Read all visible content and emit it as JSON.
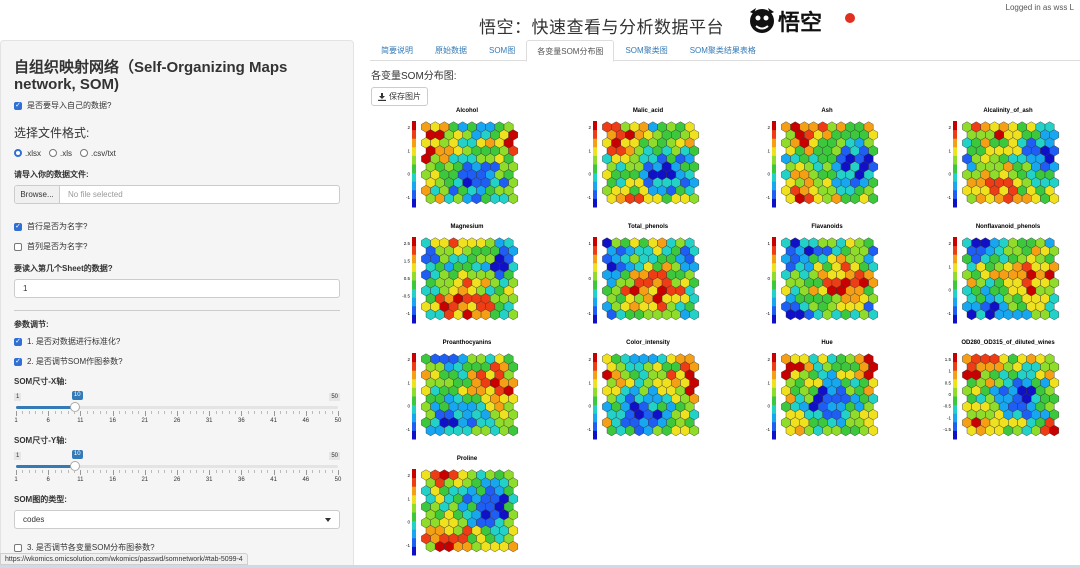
{
  "header": {
    "title": "悟空：快速查看与分析数据平台",
    "logo_text": "悟空",
    "login_text": "Logged in as wss L"
  },
  "sidebar": {
    "title": "自组织映射网络（Self-Organizing Maps network, SOM)",
    "import_own_data": {
      "label": "是否要导入自己的数据?",
      "checked": true
    },
    "file_format_label": "选择文件格式:",
    "file_formats": [
      {
        "label": ".xlsx",
        "selected": true
      },
      {
        "label": ".xls",
        "selected": false
      },
      {
        "label": ".csv/txt",
        "selected": false
      }
    ],
    "import_file_label": "请导入你的数据文件:",
    "browse_label": "Browse...",
    "file_placeholder": "No file selected",
    "first_row_names": {
      "label": "首行是否为名字?",
      "checked": true
    },
    "first_col_names": {
      "label": "首列是否为名字?",
      "checked": false
    },
    "sheet_label": "要读入第几个Sheet的数据?",
    "sheet_value": "1",
    "params_label": "参数调节:",
    "standardize": {
      "label": "1. 是否对数据进行标准化?",
      "checked": true
    },
    "adjust_som": {
      "label": "2. 是否调节SOM作图参数?",
      "checked": true
    },
    "slider_x": {
      "label": "SOM尺寸-X轴:",
      "min": "1",
      "max": "50",
      "value": "10",
      "ticks": [
        "1",
        "6",
        "11",
        "16",
        "21",
        "26",
        "31",
        "36",
        "41",
        "46",
        "50"
      ]
    },
    "slider_y": {
      "label": "SOM尺寸-Y轴:",
      "min": "1",
      "max": "50",
      "value": "10",
      "ticks": [
        "1",
        "6",
        "11",
        "16",
        "21",
        "26",
        "31",
        "36",
        "41",
        "46",
        "50"
      ]
    },
    "som_type_label": "SOM图的类型:",
    "som_type_value": "codes",
    "adjust_each_var": {
      "label": "3. 是否调节各变量SOM分布图参数?",
      "checked": false
    }
  },
  "main": {
    "tabs": [
      {
        "label": "简要说明",
        "active": false
      },
      {
        "label": "原始数据",
        "active": false
      },
      {
        "label": "SOM图",
        "active": false
      },
      {
        "label": "各变量SOM分布图",
        "active": true
      },
      {
        "label": "SOM聚类图",
        "active": false
      },
      {
        "label": "SOM聚类结果表格",
        "active": false
      }
    ],
    "heading": "各变量SOM分布图:",
    "save_button": "保存图片",
    "plots": [
      {
        "title": "Alcohol",
        "ticks": [
          "2",
          "1",
          "0",
          "-1"
        ]
      },
      {
        "title": "Malic_acid",
        "ticks": [
          "2",
          "1",
          "0",
          "-1"
        ]
      },
      {
        "title": "Ash",
        "ticks": [
          "2",
          "1",
          "0",
          "-1"
        ]
      },
      {
        "title": "Alcalinity_of_ash",
        "ticks": [
          "2",
          "1",
          "0",
          "-1"
        ]
      },
      {
        "title": "Magnesium",
        "ticks": [
          "2.5",
          "1.5",
          "0.5",
          "-0.5",
          "-1"
        ]
      },
      {
        "title": "Total_phenols",
        "ticks": [
          "1",
          "0",
          "-1"
        ]
      },
      {
        "title": "Flavanoids",
        "ticks": [
          "1",
          "0",
          "-1"
        ]
      },
      {
        "title": "Nonflavanoid_phenols",
        "ticks": [
          "2",
          "1",
          "0",
          "-1"
        ]
      },
      {
        "title": "Proanthocyanins",
        "ticks": [
          "2",
          "1",
          "0",
          "-1"
        ]
      },
      {
        "title": "Color_intensity",
        "ticks": [
          "2",
          "1",
          "0",
          "-1"
        ]
      },
      {
        "title": "Hue",
        "ticks": [
          "2",
          "1",
          "0",
          "-1"
        ]
      },
      {
        "title": "OD280_OD315_of_diluted_wines",
        "ticks": [
          "1.5",
          "1",
          "0.5",
          "0",
          "-0.5",
          "-1",
          "-1.5"
        ]
      },
      {
        "title": "Proline",
        "ticks": [
          "2",
          "1",
          "0",
          "-1"
        ]
      }
    ],
    "palette": [
      "#1010c8",
      "#1e5ef5",
      "#17a7f0",
      "#22d2c8",
      "#3cc83c",
      "#8fdc2a",
      "#f0e11e",
      "#f5a014",
      "#ee3c14",
      "#c80000"
    ]
  },
  "statusbar": {
    "url": "https://wkomics.omicsolution.com/wkomics/passwd/somnetwork/#tab-5099-4"
  }
}
